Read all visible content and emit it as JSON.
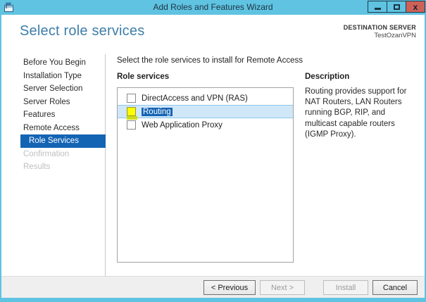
{
  "window": {
    "title": "Add Roles and Features Wizard",
    "controls": {
      "close_glyph": "x"
    }
  },
  "header": {
    "title": "Select role services",
    "destination_label": "DESTINATION SERVER",
    "destination_server": "TestOzanVPN"
  },
  "sidebar": {
    "items": [
      {
        "label": "Before You Begin",
        "state": "enabled"
      },
      {
        "label": "Installation Type",
        "state": "enabled"
      },
      {
        "label": "Server Selection",
        "state": "enabled"
      },
      {
        "label": "Server Roles",
        "state": "enabled"
      },
      {
        "label": "Features",
        "state": "enabled"
      },
      {
        "label": "Remote Access",
        "state": "enabled"
      },
      {
        "label": "Role Services",
        "state": "selected"
      },
      {
        "label": "Confirmation",
        "state": "disabled"
      },
      {
        "label": "Results",
        "state": "disabled"
      }
    ]
  },
  "main": {
    "instruction": "Select the role services to install for Remote Access",
    "list_label": "Role services",
    "role_services": [
      {
        "label": "DirectAccess and VPN (RAS)",
        "checked": false,
        "selected": false
      },
      {
        "label": "Routing",
        "checked": false,
        "selected": true,
        "checkbox_highlighted": true
      },
      {
        "label": "Web Application Proxy",
        "checked": false,
        "selected": false
      }
    ],
    "description": {
      "label": "Description",
      "text": "Routing provides support for NAT Routers, LAN Routers running BGP, RIP, and multicast capable routers (IGMP Proxy)."
    }
  },
  "footer": {
    "buttons": [
      {
        "label": "< Previous",
        "enabled": true
      },
      {
        "label": "Next >",
        "enabled": false
      },
      {
        "label": "Install",
        "enabled": false
      },
      {
        "label": "Cancel",
        "enabled": true
      }
    ]
  },
  "colors": {
    "titlebar": "#5FC3E1",
    "close_button": "#CD6157",
    "accent_blue": "#1464B4",
    "heading_blue": "#3E7EA9",
    "highlight_yellow": "#FFFF00",
    "selection_row": "#D0E7F8",
    "footer_gray": "#EFEFEF"
  }
}
